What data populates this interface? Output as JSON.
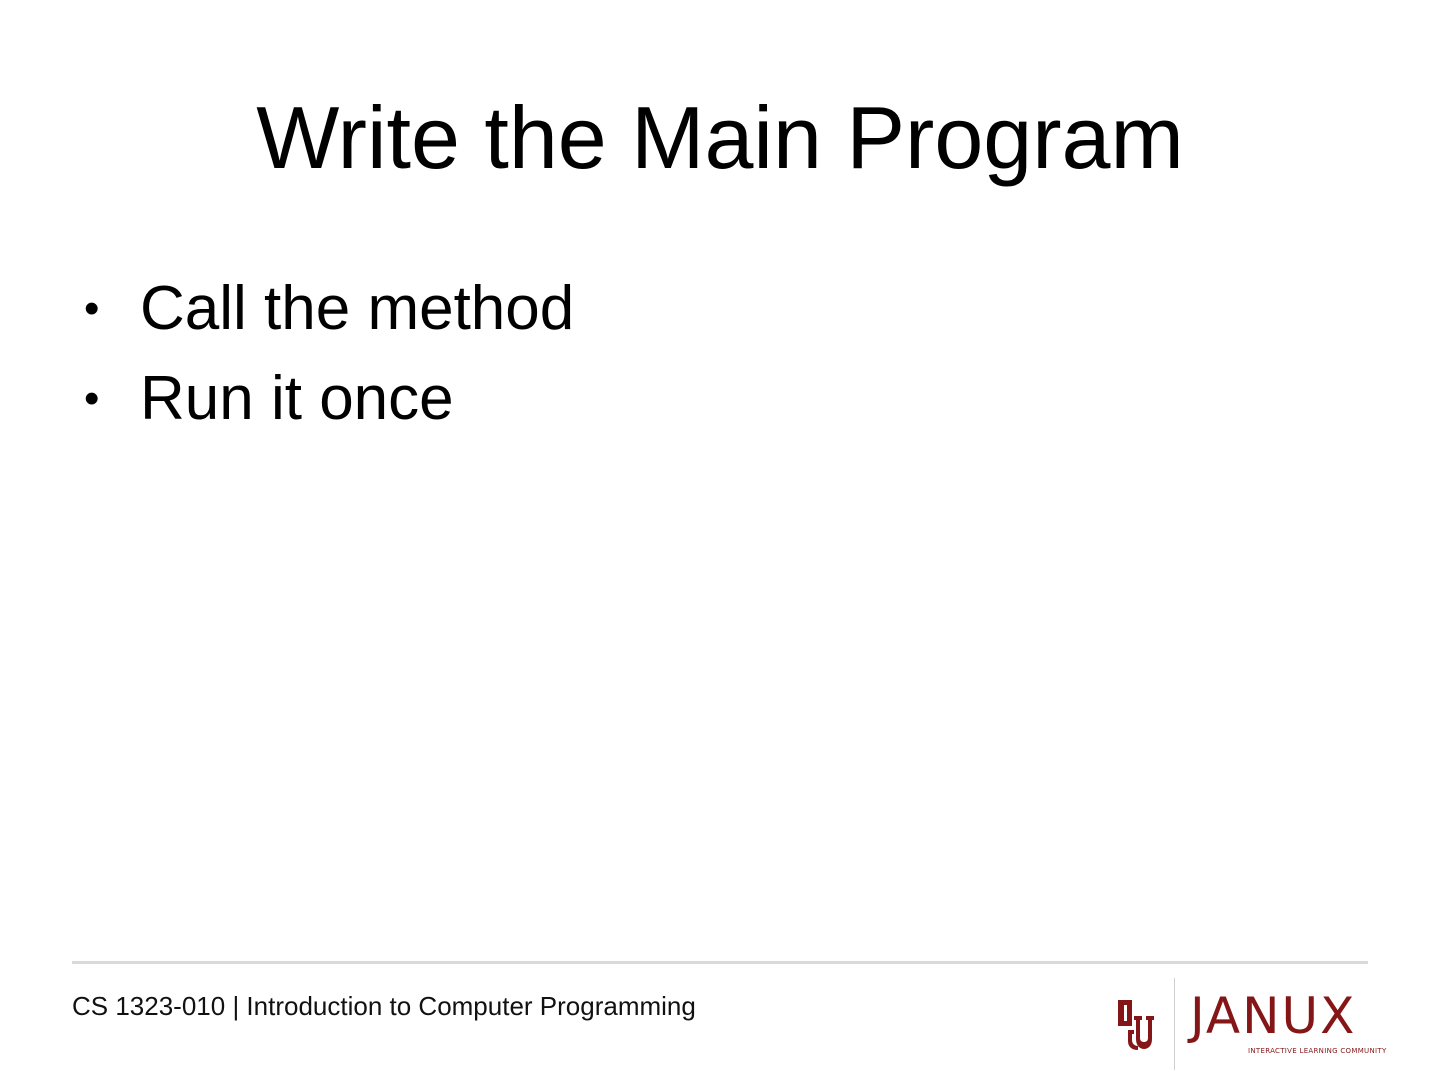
{
  "slide": {
    "title": "Write the Main Program",
    "bullets": [
      {
        "marker": "•",
        "text": "Call the method"
      },
      {
        "marker": "•",
        "text": "Run it once"
      }
    ]
  },
  "footer": {
    "course": "CS 1323-010 | Introduction to Computer Programming"
  },
  "logo": {
    "icon": "ou-monogram-icon",
    "wordmark": "JANUX",
    "tagline": "INTERACTIVE LEARNING COMMUNITY",
    "brand_color": "#841617"
  },
  "colors": {
    "background": "#ffffff",
    "text": "#000000",
    "divider": "#d9d9d9"
  }
}
